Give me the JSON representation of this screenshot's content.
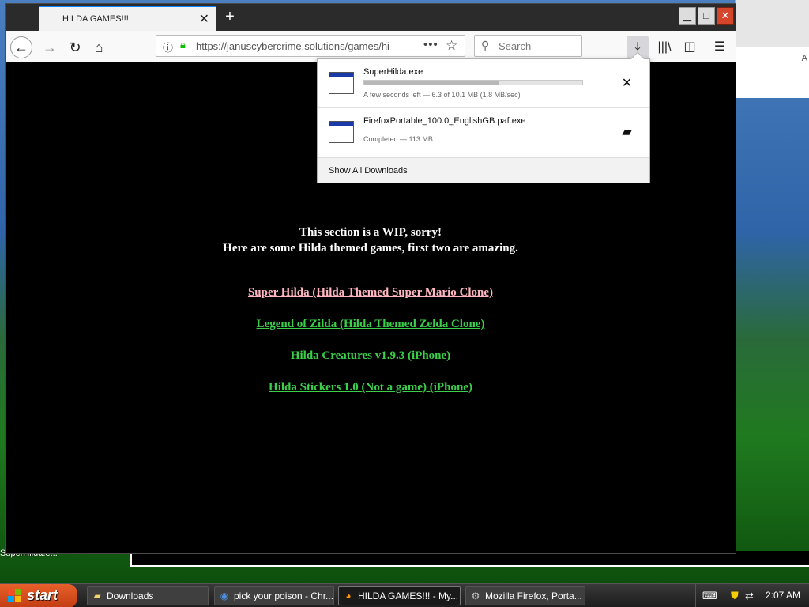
{
  "desktop": {
    "icon_label": "SuperHilda.e...",
    "bg_window_glyph": "A"
  },
  "browser": {
    "tab_title": "HILDA GAMES!!!",
    "url": "https://januscybercrime.solutions/games/hi",
    "search_placeholder": "Search",
    "accent_color": "#0a84ff"
  },
  "content": {
    "wip_line1": "This section is a WIP, sorry!",
    "wip_line2": "Here are some Hilda themed games, first two are amazing.",
    "links": [
      {
        "label": "Super Hilda (Hilda Themed Super Mario Clone)",
        "color": "#ffb6c1"
      },
      {
        "label": "Legend of Zilda (Hilda Themed Zelda Clone)",
        "color": "#3cd04a"
      },
      {
        "label": "Hilda Creatures v1.9.3 (iPhone)",
        "color": "#3cd04a"
      },
      {
        "label": "Hilda Stickers 1.0 (Not a game) (iPhone)",
        "color": "#3cd04a"
      }
    ]
  },
  "downloads": {
    "items": [
      {
        "name": "SuperHilda.exe",
        "status": "A few seconds left — 6.3 of 10.1 MB (1.8 MB/sec)",
        "progress": 0.62,
        "action_icon": "close-icon"
      },
      {
        "name": "FirefoxPortable_100.0_EnglishGB.paf.exe",
        "status": "Completed — 113 MB",
        "action_icon": "folder-icon"
      }
    ],
    "show_all": "Show All Downloads"
  },
  "taskbar": {
    "start_label": "start",
    "tasks": [
      {
        "label": "Downloads",
        "icon": "folder-icon"
      },
      {
        "label": "pick your poison - Chr...",
        "icon": "chrome-icon"
      },
      {
        "label": "HILDA GAMES!!! - My...",
        "icon": "firefox-icon"
      },
      {
        "label": "Mozilla Firefox, Porta...",
        "icon": "installer-icon"
      }
    ],
    "clock": "2:07 AM"
  }
}
